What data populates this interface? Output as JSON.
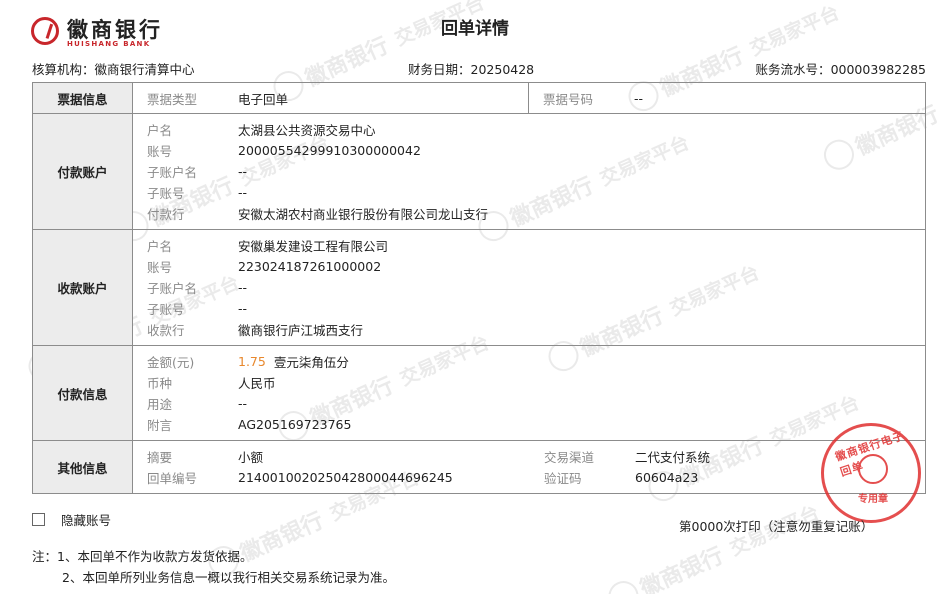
{
  "header": {
    "bank_name_cn": "徽商银行",
    "bank_name_en": "HUISHANG BANK",
    "title": "回单详情"
  },
  "meta": {
    "org_label": "核算机构：",
    "org_value": "徽商银行清算中心",
    "date_label": "财务日期：",
    "date_value": "20250428",
    "serial_label": "账务流水号：",
    "serial_value": "000003982285"
  },
  "sections": {
    "bill": {
      "label": "票据信息",
      "type_key": "票据类型",
      "type_value": "电子回单",
      "no_key": "票据号码",
      "no_value": "--"
    },
    "payer": {
      "label": "付款账户",
      "fields": [
        {
          "k": "户名",
          "v": "太湖县公共资源交易中心"
        },
        {
          "k": "账号",
          "v": "20000554299910300000042"
        },
        {
          "k": "子账户名",
          "v": "--"
        },
        {
          "k": "子账号",
          "v": "--"
        },
        {
          "k": "付款行",
          "v": "安徽太湖农村商业银行股份有限公司龙山支行"
        }
      ]
    },
    "payee": {
      "label": "收款账户",
      "fields": [
        {
          "k": "户名",
          "v": "安徽巢发建设工程有限公司"
        },
        {
          "k": "账号",
          "v": "223024187261000002"
        },
        {
          "k": "子账户名",
          "v": "--"
        },
        {
          "k": "子账号",
          "v": "--"
        },
        {
          "k": "收款行",
          "v": "徽商银行庐江城西支行"
        }
      ]
    },
    "payment": {
      "label": "付款信息",
      "amount_key": "金额(元)",
      "amount_value": "1.75",
      "amount_words": "壹元柒角伍分",
      "fields": [
        {
          "k": "币种",
          "v": "人民币"
        },
        {
          "k": "用途",
          "v": "--"
        },
        {
          "k": "附言",
          "v": "AG205169723765"
        }
      ]
    },
    "other": {
      "label": "其他信息",
      "summary_key": "摘要",
      "summary_value": "小额",
      "channel_key": "交易渠道",
      "channel_value": "二代支付系统",
      "receipt_no_key": "回单编号",
      "receipt_no_value": "21400100202504280004469624​5",
      "verify_key": "验证码",
      "verify_value": "60604a23"
    }
  },
  "footer": {
    "hide_account_label": "隐藏账号",
    "print_info": "第0000次打印（注意勿重复记账）",
    "notes": [
      "注：1、本回单不作为收款方发货依据。",
      "2、本回单所列业务信息一概以我行相关交易系统记录为准。"
    ]
  },
  "seal": {
    "top_text": "徽商银行电子回单",
    "bottom_text": "专用章"
  },
  "watermark": {
    "text1": "徽商银行",
    "text2": "交易家平台"
  },
  "colors": {
    "brand_red": "#c8262b",
    "seal_red": "#e03030",
    "amount_orange": "#e8882d",
    "label_bg": "#ececec"
  }
}
